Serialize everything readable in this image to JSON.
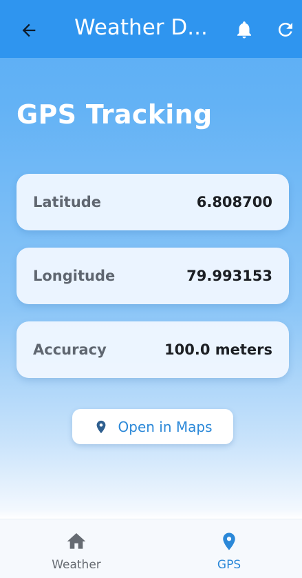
{
  "appbar": {
    "title": "Weather D...",
    "back_icon": "back-arrow-icon",
    "bell_icon": "bell-icon",
    "refresh_icon": "refresh-icon",
    "background": "#2f95ef"
  },
  "page": {
    "heading": "GPS Tracking"
  },
  "cards": [
    {
      "label": "Latitude",
      "value": "6.808700"
    },
    {
      "label": "Longitude",
      "value": "79.993153"
    },
    {
      "label": "Accuracy",
      "value": "100.0 meters"
    }
  ],
  "maps_button": {
    "label": "Open in Maps",
    "icon": "location-pin-icon"
  },
  "bottom_nav": {
    "items": [
      {
        "label": "Weather",
        "icon": "home-icon",
        "active": false
      },
      {
        "label": "GPS",
        "icon": "location-pin-icon",
        "active": true
      }
    ],
    "active_color": "#2b88d8",
    "inactive_color": "#666b72"
  }
}
